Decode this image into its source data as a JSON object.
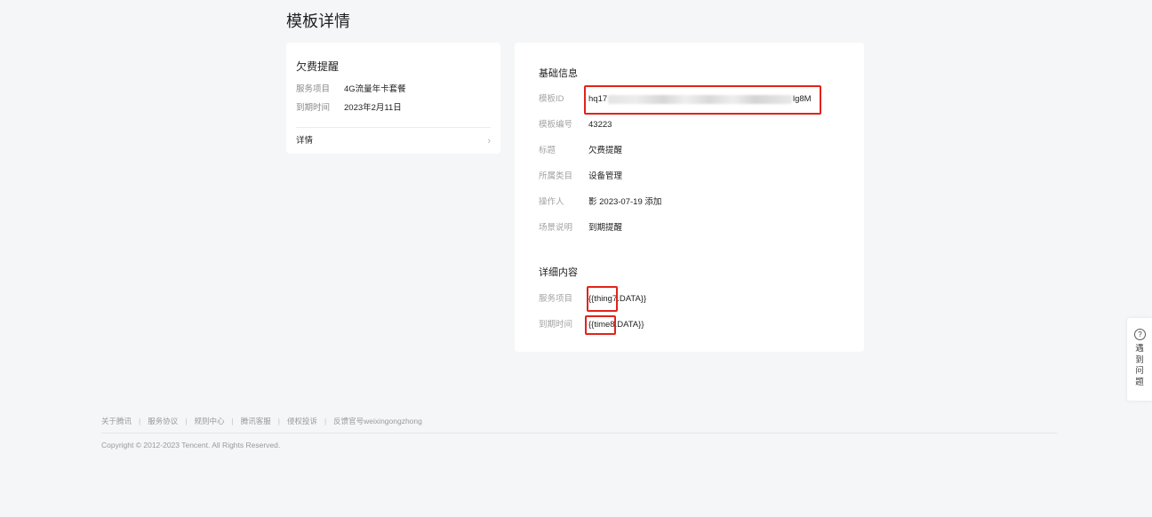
{
  "page": {
    "title": "模板详情"
  },
  "preview": {
    "title": "欠费提醒",
    "rows": [
      {
        "label": "服务项目",
        "value": "4G流量年卡套餐"
      },
      {
        "label": "到期时间",
        "value": "2023年2月11日"
      }
    ],
    "detail_label": "详情",
    "chevron": "›"
  },
  "basic_info": {
    "section_title": "基础信息",
    "template_id": {
      "label": "模板ID",
      "value_prefix": "hq17",
      "value_suffix": "lg8M"
    },
    "template_number": {
      "label": "模板编号",
      "value": "43223"
    },
    "title": {
      "label": "标题",
      "value": "欠费提醒"
    },
    "category": {
      "label": "所属类目",
      "value": "设备管理"
    },
    "operator": {
      "label": "操作人",
      "value": "影 2023-07-19 添加"
    },
    "scene": {
      "label": "场景说明",
      "value": "到期提醒"
    }
  },
  "detail_content": {
    "section_title": "详细内容",
    "rows": [
      {
        "label": "服务项目",
        "value": "{{thing7.DATA}}"
      },
      {
        "label": "到期时间",
        "value": "{{time8.DATA}}"
      }
    ]
  },
  "footer": {
    "links": [
      "关于腾讯",
      "服务协议",
      "规则中心",
      "腾讯客服",
      "侵权投诉",
      "反馈官号weixingongzhong"
    ],
    "separator": "|",
    "copyright": "Copyright © 2012-2023 Tencent. All Rights Reserved."
  },
  "help": {
    "icon_glyph": "?",
    "text": "遇到问题"
  },
  "colors": {
    "background": "#f5f6f7",
    "card": "#ffffff",
    "highlight": "#e0241b"
  }
}
